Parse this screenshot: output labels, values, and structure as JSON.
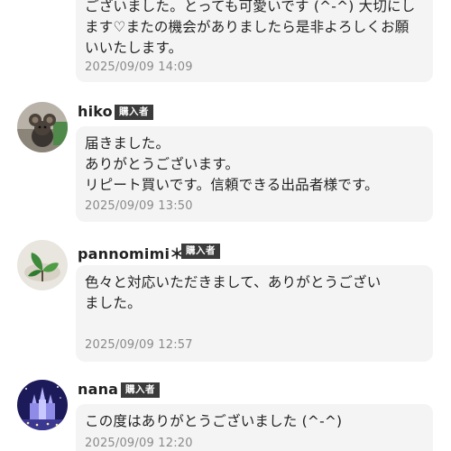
{
  "buyer_badge": "購入者",
  "comments": [
    {
      "message": "ございました。とっても可愛いです (^-^) 大切にし\nます♡またの機会がありましたら是非よろしくお願\nいいたします。",
      "timestamp": "2025/09/09 14:09"
    },
    {
      "username": "hiko",
      "message": "届きました。\nありがとうございます。\nリピート買いです。信頼できる出品者様です。",
      "timestamp": "2025/09/09 13:50"
    },
    {
      "username": "pannomimi＊",
      "message": "色々と対応いただきまして、ありがとうござい\nました。",
      "timestamp": "2025/09/09 12:57"
    },
    {
      "username": "nana",
      "message": "この度はありがとうございました (^-^)",
      "timestamp": "2025/09/09 12:20"
    }
  ]
}
